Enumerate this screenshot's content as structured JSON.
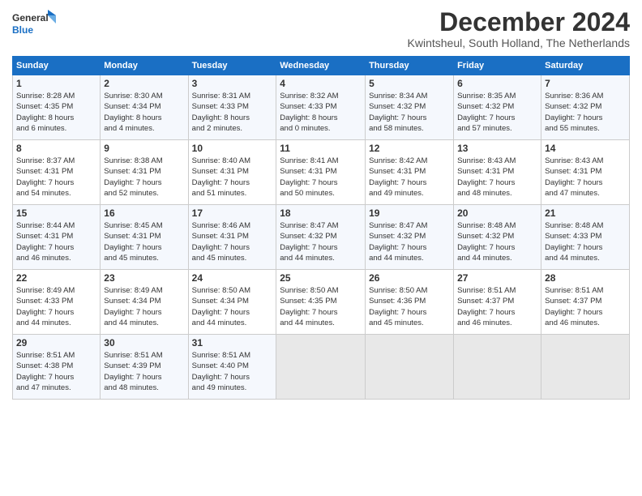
{
  "header": {
    "logo_line1": "General",
    "logo_line2": "Blue",
    "title": "December 2024",
    "subtitle": "Kwintsheul, South Holland, The Netherlands"
  },
  "columns": [
    "Sunday",
    "Monday",
    "Tuesday",
    "Wednesday",
    "Thursday",
    "Friday",
    "Saturday"
  ],
  "weeks": [
    [
      {
        "day": "1",
        "info": "Sunrise: 8:28 AM\nSunset: 4:35 PM\nDaylight: 8 hours\nand 6 minutes."
      },
      {
        "day": "2",
        "info": "Sunrise: 8:30 AM\nSunset: 4:34 PM\nDaylight: 8 hours\nand 4 minutes."
      },
      {
        "day": "3",
        "info": "Sunrise: 8:31 AM\nSunset: 4:33 PM\nDaylight: 8 hours\nand 2 minutes."
      },
      {
        "day": "4",
        "info": "Sunrise: 8:32 AM\nSunset: 4:33 PM\nDaylight: 8 hours\nand 0 minutes."
      },
      {
        "day": "5",
        "info": "Sunrise: 8:34 AM\nSunset: 4:32 PM\nDaylight: 7 hours\nand 58 minutes."
      },
      {
        "day": "6",
        "info": "Sunrise: 8:35 AM\nSunset: 4:32 PM\nDaylight: 7 hours\nand 57 minutes."
      },
      {
        "day": "7",
        "info": "Sunrise: 8:36 AM\nSunset: 4:32 PM\nDaylight: 7 hours\nand 55 minutes."
      }
    ],
    [
      {
        "day": "8",
        "info": "Sunrise: 8:37 AM\nSunset: 4:31 PM\nDaylight: 7 hours\nand 54 minutes."
      },
      {
        "day": "9",
        "info": "Sunrise: 8:38 AM\nSunset: 4:31 PM\nDaylight: 7 hours\nand 52 minutes."
      },
      {
        "day": "10",
        "info": "Sunrise: 8:40 AM\nSunset: 4:31 PM\nDaylight: 7 hours\nand 51 minutes."
      },
      {
        "day": "11",
        "info": "Sunrise: 8:41 AM\nSunset: 4:31 PM\nDaylight: 7 hours\nand 50 minutes."
      },
      {
        "day": "12",
        "info": "Sunrise: 8:42 AM\nSunset: 4:31 PM\nDaylight: 7 hours\nand 49 minutes."
      },
      {
        "day": "13",
        "info": "Sunrise: 8:43 AM\nSunset: 4:31 PM\nDaylight: 7 hours\nand 48 minutes."
      },
      {
        "day": "14",
        "info": "Sunrise: 8:43 AM\nSunset: 4:31 PM\nDaylight: 7 hours\nand 47 minutes."
      }
    ],
    [
      {
        "day": "15",
        "info": "Sunrise: 8:44 AM\nSunset: 4:31 PM\nDaylight: 7 hours\nand 46 minutes."
      },
      {
        "day": "16",
        "info": "Sunrise: 8:45 AM\nSunset: 4:31 PM\nDaylight: 7 hours\nand 45 minutes."
      },
      {
        "day": "17",
        "info": "Sunrise: 8:46 AM\nSunset: 4:31 PM\nDaylight: 7 hours\nand 45 minutes."
      },
      {
        "day": "18",
        "info": "Sunrise: 8:47 AM\nSunset: 4:32 PM\nDaylight: 7 hours\nand 44 minutes."
      },
      {
        "day": "19",
        "info": "Sunrise: 8:47 AM\nSunset: 4:32 PM\nDaylight: 7 hours\nand 44 minutes."
      },
      {
        "day": "20",
        "info": "Sunrise: 8:48 AM\nSunset: 4:32 PM\nDaylight: 7 hours\nand 44 minutes."
      },
      {
        "day": "21",
        "info": "Sunrise: 8:48 AM\nSunset: 4:33 PM\nDaylight: 7 hours\nand 44 minutes."
      }
    ],
    [
      {
        "day": "22",
        "info": "Sunrise: 8:49 AM\nSunset: 4:33 PM\nDaylight: 7 hours\nand 44 minutes."
      },
      {
        "day": "23",
        "info": "Sunrise: 8:49 AM\nSunset: 4:34 PM\nDaylight: 7 hours\nand 44 minutes."
      },
      {
        "day": "24",
        "info": "Sunrise: 8:50 AM\nSunset: 4:34 PM\nDaylight: 7 hours\nand 44 minutes."
      },
      {
        "day": "25",
        "info": "Sunrise: 8:50 AM\nSunset: 4:35 PM\nDaylight: 7 hours\nand 44 minutes."
      },
      {
        "day": "26",
        "info": "Sunrise: 8:50 AM\nSunset: 4:36 PM\nDaylight: 7 hours\nand 45 minutes."
      },
      {
        "day": "27",
        "info": "Sunrise: 8:51 AM\nSunset: 4:37 PM\nDaylight: 7 hours\nand 46 minutes."
      },
      {
        "day": "28",
        "info": "Sunrise: 8:51 AM\nSunset: 4:37 PM\nDaylight: 7 hours\nand 46 minutes."
      }
    ],
    [
      {
        "day": "29",
        "info": "Sunrise: 8:51 AM\nSunset: 4:38 PM\nDaylight: 7 hours\nand 47 minutes."
      },
      {
        "day": "30",
        "info": "Sunrise: 8:51 AM\nSunset: 4:39 PM\nDaylight: 7 hours\nand 48 minutes."
      },
      {
        "day": "31",
        "info": "Sunrise: 8:51 AM\nSunset: 4:40 PM\nDaylight: 7 hours\nand 49 minutes."
      },
      {
        "day": "",
        "info": ""
      },
      {
        "day": "",
        "info": ""
      },
      {
        "day": "",
        "info": ""
      },
      {
        "day": "",
        "info": ""
      }
    ]
  ]
}
